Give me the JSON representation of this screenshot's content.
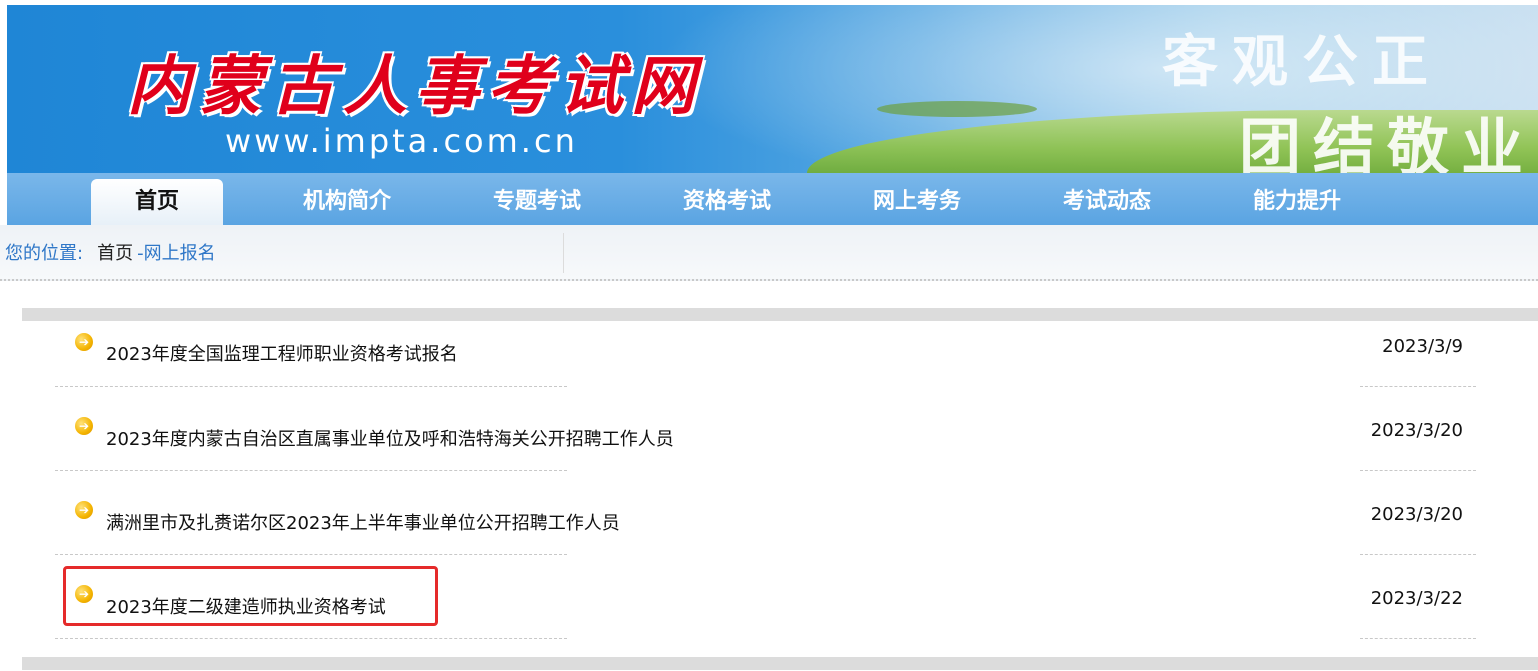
{
  "header": {
    "site_title": "内蒙古人事考试网",
    "site_url": "www.impta.com.cn",
    "slogan_line1": "客观公正",
    "slogan_line2": "团结敬业"
  },
  "nav": {
    "items": [
      {
        "label": "首页",
        "active": true
      },
      {
        "label": "机构简介"
      },
      {
        "label": "专题考试"
      },
      {
        "label": "资格考试"
      },
      {
        "label": "网上考务"
      },
      {
        "label": "考试动态"
      },
      {
        "label": "能力提升"
      }
    ]
  },
  "breadcrumb": {
    "label": "您的位置:",
    "home": "首页",
    "current": "-网上报名"
  },
  "list": {
    "items": [
      {
        "title": "2023年度全国监理工程师职业资格考试报名",
        "date": "2023/3/9"
      },
      {
        "title": "2023年度内蒙古自治区直属事业单位及呼和浩特海关公开招聘工作人员",
        "date": "2023/3/20"
      },
      {
        "title": "满洲里市及扎赉诺尔区2023年上半年事业单位公开招聘工作人员",
        "date": "2023/3/20"
      },
      {
        "title": "2023年度二级建造师执业资格考试",
        "date": "2023/3/22"
      }
    ]
  },
  "colors": {
    "banner_blue": "#1f86d6",
    "nav_blue": "#5aa4e2",
    "title_red": "#e0001b",
    "highlight_red": "#e52a2a",
    "link_blue": "#2f77c8"
  }
}
